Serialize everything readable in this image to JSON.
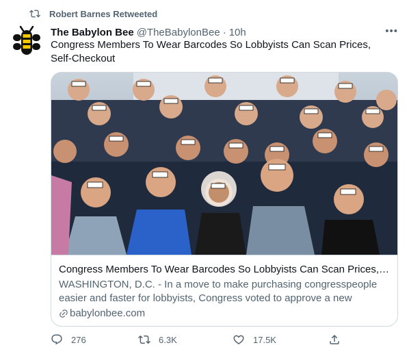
{
  "retweet": {
    "label": "Robert Barnes Retweeted"
  },
  "tweet": {
    "name": "The Babylon Bee",
    "handle": "@TheBabylonBee",
    "separator": "·",
    "time": "10h",
    "more": "•••",
    "text": "Congress Members To Wear Barcodes So Lobbyists Can Scan Prices, Self-Checkout"
  },
  "card": {
    "title": "Congress Members To Wear Barcodes So Lobbyists Can Scan Prices, Self...",
    "description": "WASHINGTON, D.C. - In a move to make purchasing congresspeople easier and faster for lobbyists, Congress voted to approve a new measur...",
    "domain": "babylonbee.com"
  },
  "actions": {
    "replies": "276",
    "retweets": "6.3K",
    "likes": "17.5K"
  },
  "colors": {
    "secondary_text": "#536471",
    "border": "#cfd9de",
    "logo_yellow": "#f5c800",
    "logo_dark": "#111111"
  },
  "icons": [
    "retweet-icon",
    "more-icon",
    "link-icon",
    "reply-icon",
    "like-icon",
    "share-icon"
  ]
}
